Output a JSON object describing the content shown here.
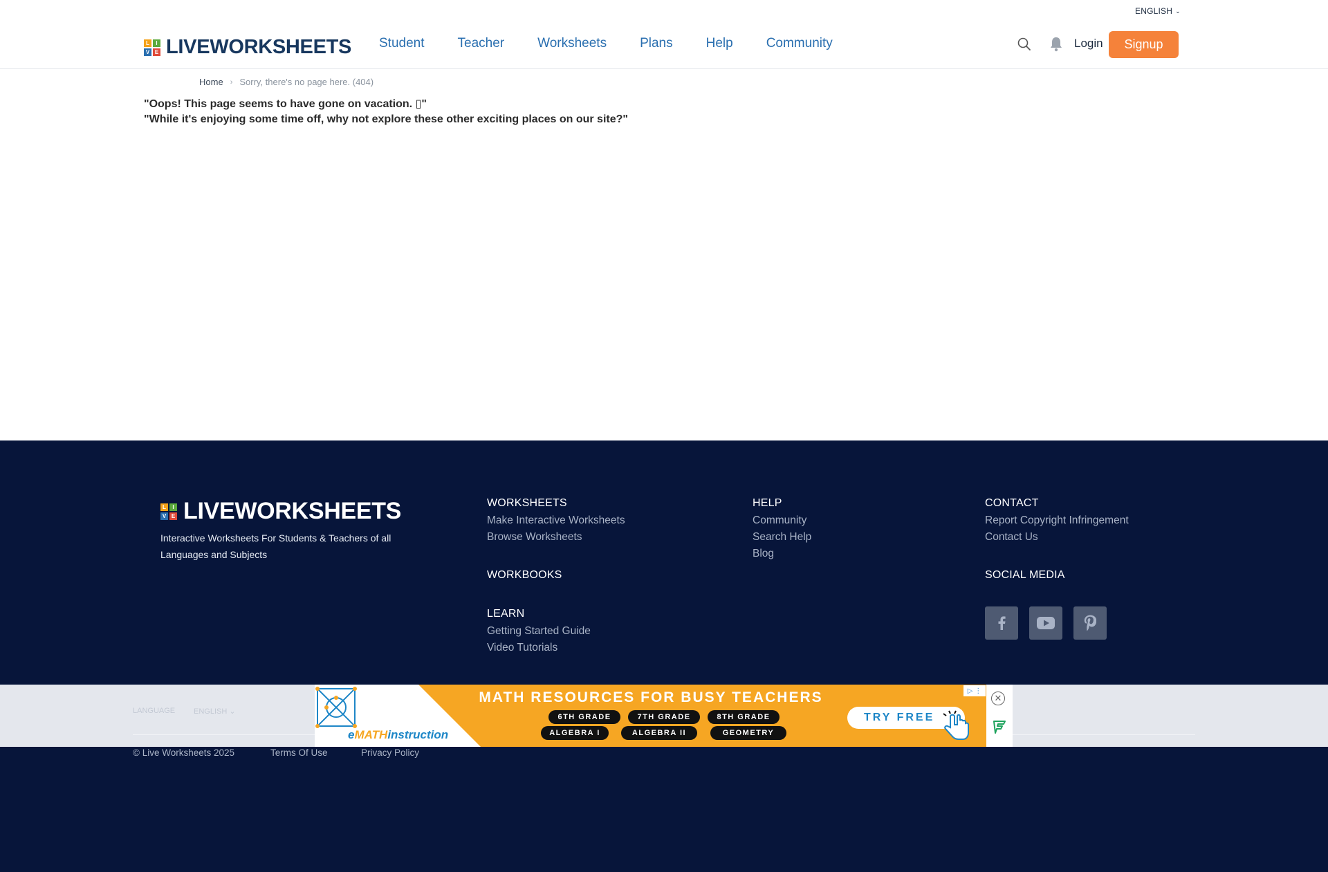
{
  "header": {
    "language": "ENGLISH",
    "logo_text": "LIVEWORKSHEETS",
    "logo_letters": [
      "L",
      "I",
      "V",
      "E"
    ],
    "nav": [
      "Student",
      "Teacher",
      "Worksheets",
      "Plans",
      "Help",
      "Community"
    ],
    "login": "Login",
    "signup": "Signup"
  },
  "breadcrumb": {
    "home": "Home",
    "current": "Sorry, there's no page here. (404)"
  },
  "message": {
    "line1": "\"Oops! This page seems to have gone on vacation. ▯\"",
    "line2": "\"While it's enjoying some time off, why not explore these other exciting places on our site?\""
  },
  "footer": {
    "logo_text": "LIVEWORKSHEETS",
    "tagline": "Interactive Worksheets For Students & Teachers of all Languages and Subjects",
    "worksheets": {
      "title": "WORKSHEETS",
      "links": [
        "Make Interactive Worksheets",
        "Browse Worksheets"
      ]
    },
    "workbooks": {
      "title": "WORKBOOKS"
    },
    "learn": {
      "title": "LEARN",
      "links": [
        "Getting Started Guide",
        "Video Tutorials"
      ]
    },
    "help": {
      "title": "HELP",
      "links": [
        "Community",
        "Search Help",
        "Blog"
      ]
    },
    "contact": {
      "title": "CONTACT",
      "links": [
        "Report Copyright Infringement",
        "Contact Us"
      ]
    },
    "social": {
      "title": "SOCIAL MEDIA",
      "icons": [
        "facebook-icon",
        "youtube-icon",
        "pinterest-icon"
      ]
    },
    "language_label": "LANGUAGE",
    "language_value": "ENGLISH",
    "copyright": "© Live Worksheets 2025",
    "terms": "Terms Of Use",
    "privacy": "Privacy Policy"
  },
  "ad": {
    "brand_prefix": "e",
    "brand_highlight": "MATH",
    "brand_suffix": "instruction",
    "title": "MATH RESOURCES FOR BUSY TEACHERS",
    "pills": [
      "6TH GRADE",
      "7TH GRADE",
      "8TH GRADE",
      "ALGEBRA I",
      "ALGEBRA II",
      "GEOMETRY"
    ],
    "cta": "TRY FREE"
  },
  "colors": {
    "brand_blue": "#17375e",
    "nav_blue": "#2a6fb0",
    "signup_orange": "#f5823a",
    "footer_bg": "#07153a",
    "ad_orange": "#f6a623"
  }
}
